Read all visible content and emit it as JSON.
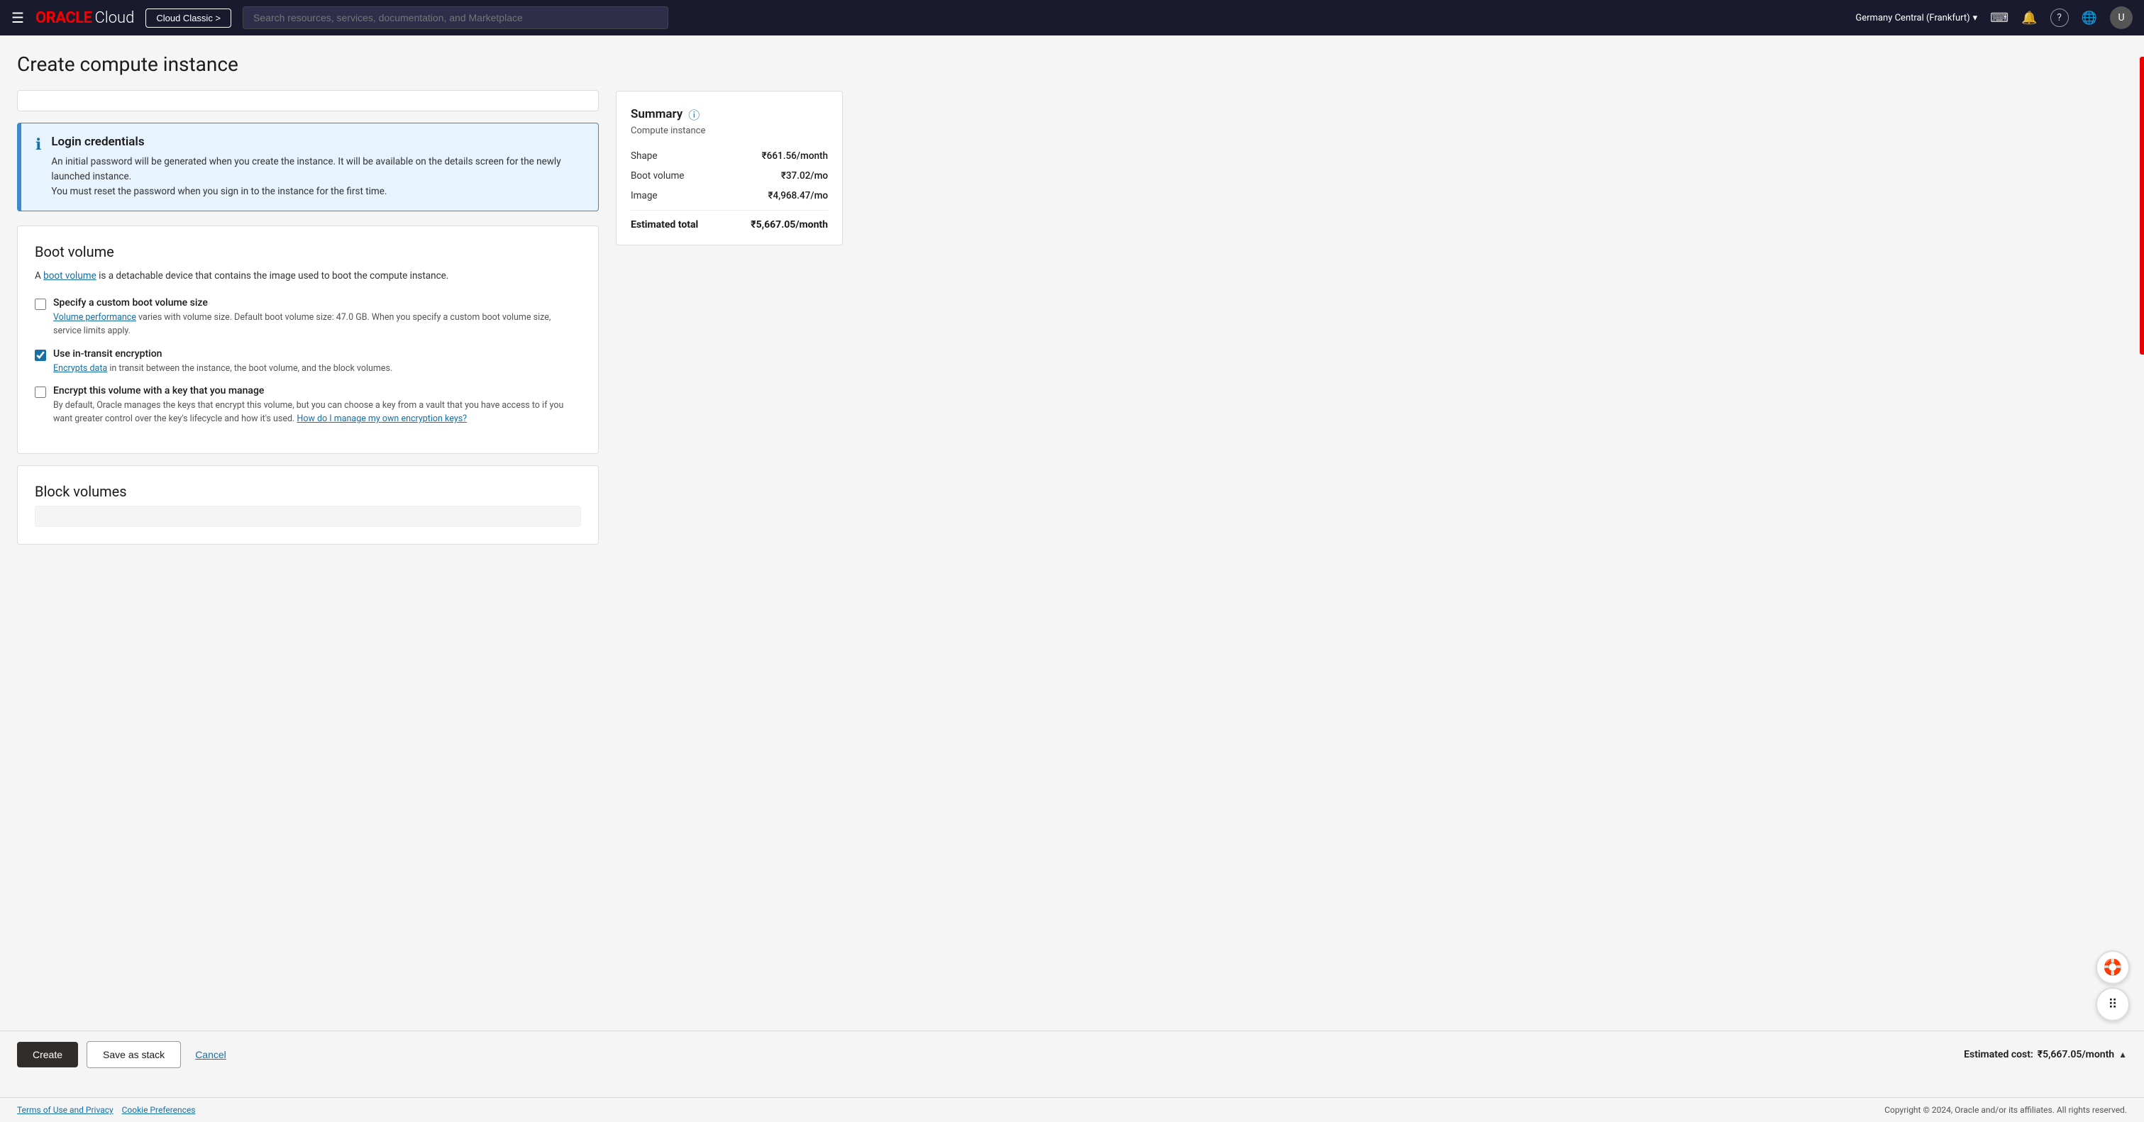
{
  "topnav": {
    "hamburger": "☰",
    "logo_oracle": "ORACLE",
    "logo_cloud": "Cloud",
    "classic_btn": "Cloud Classic >",
    "search_placeholder": "Search resources, services, documentation, and Marketplace",
    "region": "Germany Central (Frankfurt)",
    "region_chevron": "▾",
    "icons": {
      "terminal": "⌨",
      "bell": "🔔",
      "help": "?",
      "globe": "🌐"
    },
    "avatar_initial": "U"
  },
  "page": {
    "title": "Create compute instance"
  },
  "login_credentials": {
    "title": "Login credentials",
    "body_line1": "An initial password will be generated when you create the instance. It will be available on the details screen for the newly launched instance.",
    "body_line2": "You must reset the password when you sign in to the instance for the first time."
  },
  "boot_volume": {
    "title": "Boot volume",
    "description_pre": "A ",
    "description_link": "boot volume",
    "description_post": " is a detachable device that contains the image used to boot the compute instance.",
    "custom_size": {
      "label": "Specify a custom boot volume size",
      "sublabel_link": "Volume performance",
      "sublabel_post": " varies with volume size. Default boot volume size: 47.0 GB. When you specify a custom boot volume size, service limits apply.",
      "checked": false
    },
    "in_transit": {
      "label": "Use in-transit encryption",
      "sublabel_link": "Encrypts data",
      "sublabel_post": " in transit between the instance, the boot volume, and the block volumes.",
      "checked": true
    },
    "encrypt_volume": {
      "label": "Encrypt this volume with a key that you manage",
      "sublabel_pre": "By default, Oracle manages the keys that encrypt this volume, but you can choose a key from a vault that you have access to if you want greater control over the key's lifecycle and how it's used. ",
      "sublabel_link": "How do I manage my own encryption keys?",
      "checked": false
    }
  },
  "block_volumes": {
    "title": "Block volumes"
  },
  "summary": {
    "title": "Summary",
    "info_icon": "ⓘ",
    "subtitle": "Compute instance",
    "shape_label": "Shape",
    "shape_value": "₹661.56/month",
    "boot_volume_label": "Boot volume",
    "boot_volume_value": "₹37.02/mo",
    "image_label": "Image",
    "image_value": "₹4,968.47/mo",
    "estimated_total_label": "Estimated total",
    "estimated_total_value": "₹5,667.05/month"
  },
  "bottom_bar": {
    "create_btn": "Create",
    "stack_btn": "Save as stack",
    "cancel_btn": "Cancel",
    "estimated_cost_label": "Estimated cost:",
    "estimated_cost_value": "₹5,667.05/month",
    "chevron": "▲"
  },
  "footer": {
    "left_links": [
      "Terms of Use and Privacy",
      "Cookie Preferences"
    ],
    "right_text": "Copyright © 2024, Oracle and/or its affiliates. All rights reserved."
  }
}
